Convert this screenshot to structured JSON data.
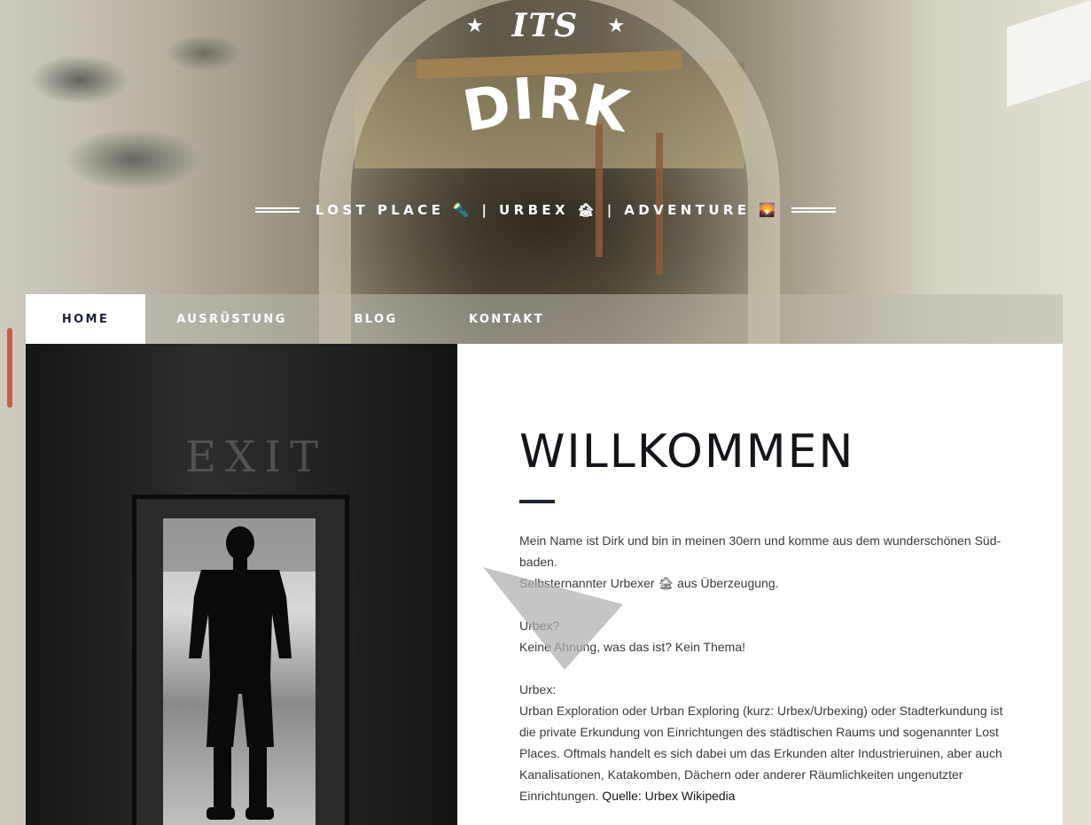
{
  "logo": {
    "top": "ITS",
    "name": "DIRK",
    "letters": [
      "D",
      "I",
      "R",
      "K"
    ],
    "star_icon": "star-icon"
  },
  "tagline": "LOST PLACE 🔦 | URBEX 🏚 | ADVENTURE 🌄",
  "nav": {
    "items": [
      {
        "label": "HOME",
        "active": true
      },
      {
        "label": "AUSRÜSTUNG",
        "active": false
      },
      {
        "label": "BLOG",
        "active": false
      },
      {
        "label": "KONTAKT",
        "active": false
      }
    ]
  },
  "main": {
    "title": "WILLKOMMEN",
    "paragraphs": {
      "p1_line1": "Mein Name ist Dirk und bin in meinen 30ern und komme aus dem wunderschönen Süd-baden.",
      "p1_line2": "Selbsternannter Urbexer 🏚 aus Überzeugung.",
      "p2_line1": "Urbex?",
      "p2_line2": "Keine Ahnung, was das ist? Kein Thema!",
      "p3_line1": "Urbex:",
      "p3_line2": "Urban Exploration oder Urban Exploring (kurz: Urbex/Urbexing) oder Stadterkundung ist die private Erkundung von Einrichtungen des städtischen Raums und sogenannter Lost Places. Oftmals handelt es sich dabei um das Erkunden alter Industrieruinen, aber auch Kanalisationen, Katakomben, Dächern oder anderer Räumlichkeiten ungenutzter Einrichtungen.",
      "source_link": "Quelle: Urbex Wikipedia"
    }
  },
  "colors": {
    "nav_active_text": "#1f2233",
    "title_rule": "#1f2233",
    "body_text": "#3a3a3a"
  }
}
